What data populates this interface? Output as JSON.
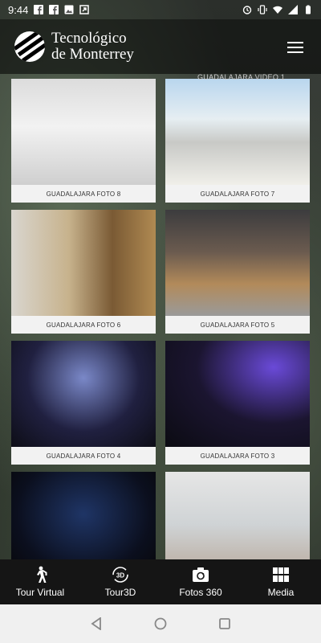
{
  "status_bar": {
    "time": "9:44"
  },
  "header": {
    "logo_line1": "Tecnológico",
    "logo_line2": "de Monterrey",
    "peek_caption": "GUADALAJARA VIDEO 1"
  },
  "gallery": {
    "items": [
      {
        "caption": "GUADALAJARA FOTO 8"
      },
      {
        "caption": "GUADALAJARA FOTO 7"
      },
      {
        "caption": "GUADALAJARA FOTO 6"
      },
      {
        "caption": "GUADALAJARA FOTO 5"
      },
      {
        "caption": "GUADALAJARA FOTO 4"
      },
      {
        "caption": "GUADALAJARA FOTO 3"
      },
      {
        "caption": ""
      },
      {
        "caption": ""
      }
    ]
  },
  "tabs": [
    {
      "label": "Tour Virtual",
      "icon": "walking-person-icon"
    },
    {
      "label": "Tour3D",
      "icon": "3d-rotate-icon"
    },
    {
      "label": "Fotos 360",
      "icon": "camera-rotate-icon"
    },
    {
      "label": "Media",
      "icon": "grid-icon"
    }
  ],
  "colors": {
    "tabbar_bg": "#151515",
    "header_bg": "#000000",
    "card_bg": "#f2f2f2"
  }
}
